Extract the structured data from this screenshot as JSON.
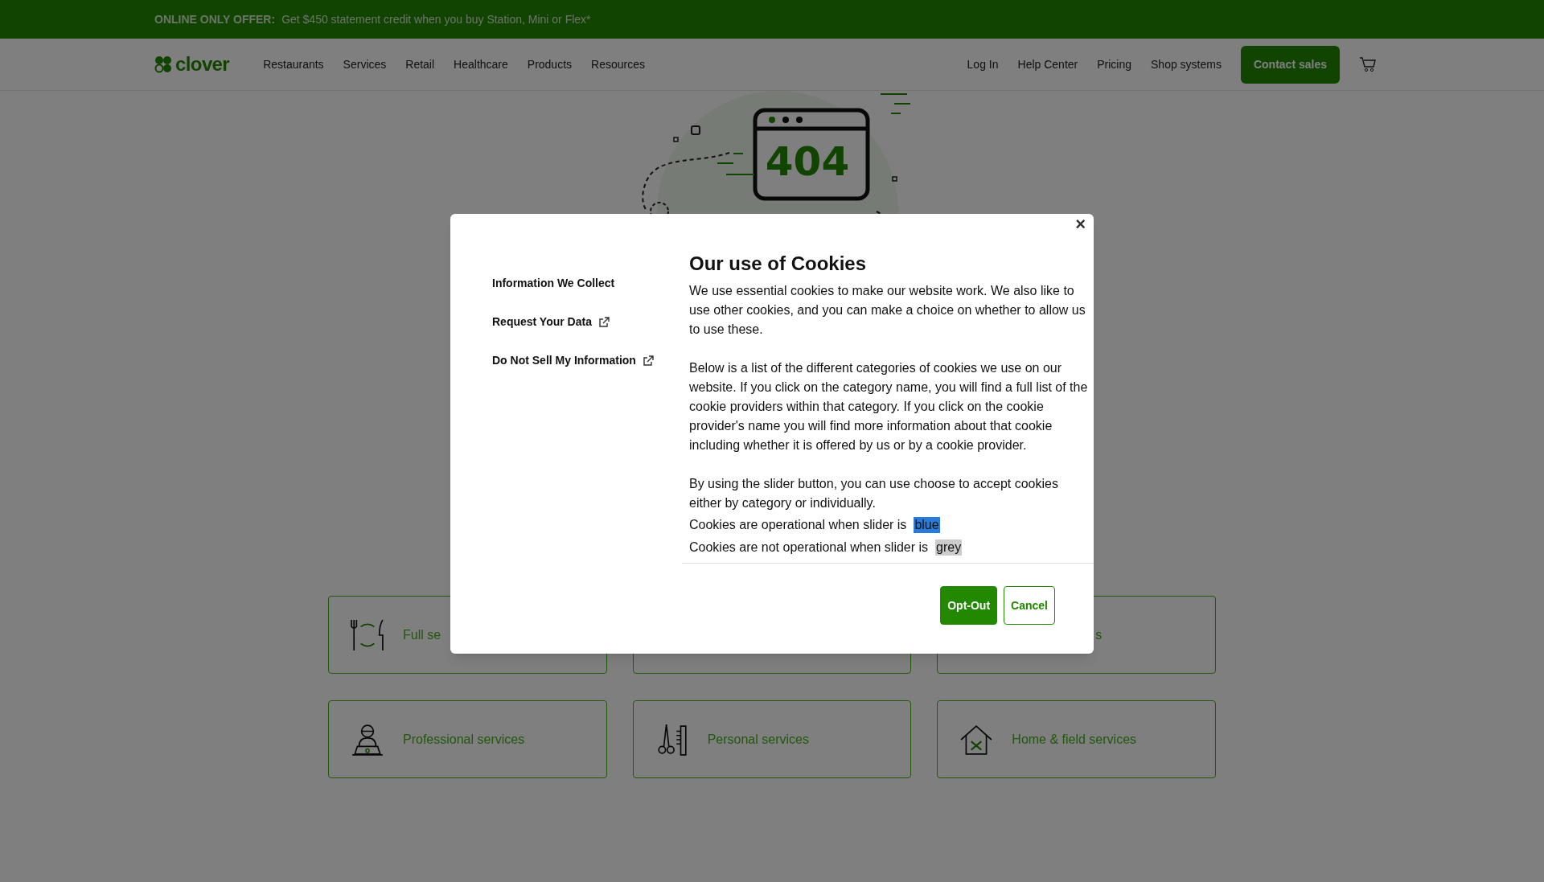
{
  "banner": {
    "label": "ONLINE ONLY OFFER:",
    "text": "Get $450 statement credit when you buy Station, Mini or Flex*"
  },
  "nav": {
    "logo": "clover",
    "links": [
      "Restaurants",
      "Services",
      "Retail",
      "Healthcare",
      "Products",
      "Resources"
    ],
    "right_links": [
      "Log In",
      "Help Center",
      "Pricing",
      "Shop systems"
    ],
    "cta": "Contact sales"
  },
  "hero": {
    "code": "404"
  },
  "service_cards": [
    {
      "kind": "dining",
      "title": "Full se"
    },
    {
      "kind": "covered"
    },
    {
      "kind": "covered",
      "title": "s"
    },
    {
      "kind": "professional",
      "title": "Professional services"
    },
    {
      "kind": "personal",
      "title": "Personal services"
    },
    {
      "kind": "home",
      "title": "Home & field services"
    }
  ],
  "modal": {
    "close": "×",
    "sidebar": [
      {
        "label": "Information We Collect",
        "external": false
      },
      {
        "label": "Request Your Data",
        "external": true
      },
      {
        "label": "Do Not Sell My Information",
        "external": true
      }
    ],
    "title": "Our use of Cookies",
    "paragraphs": [
      "We use essential cookies to make our website work. We also like to use other cookies, and you can make a choice on whether to allow us to use these.",
      "Below is a list of the different categories of cookies we use on our website. If you click on the category name, you will find a full list of the cookie providers within that category. If you click on the cookie provider's name you will find more information about that cookie including whether it is offered by us or by a cookie provider.",
      "By using the slider button, you can use choose to accept cookies either by category or individually."
    ],
    "legend": [
      {
        "text": "Cookies are operational when slider is",
        "swatch": "blue",
        "color": "#2a7ad8"
      },
      {
        "text": "Cookies are not operational when slider is",
        "swatch": "grey",
        "color": "#cccccc"
      }
    ],
    "buttons": [
      {
        "label": "Opt-Out",
        "kind": "primary"
      },
      {
        "label": "Cancel",
        "kind": "secondary"
      }
    ]
  }
}
